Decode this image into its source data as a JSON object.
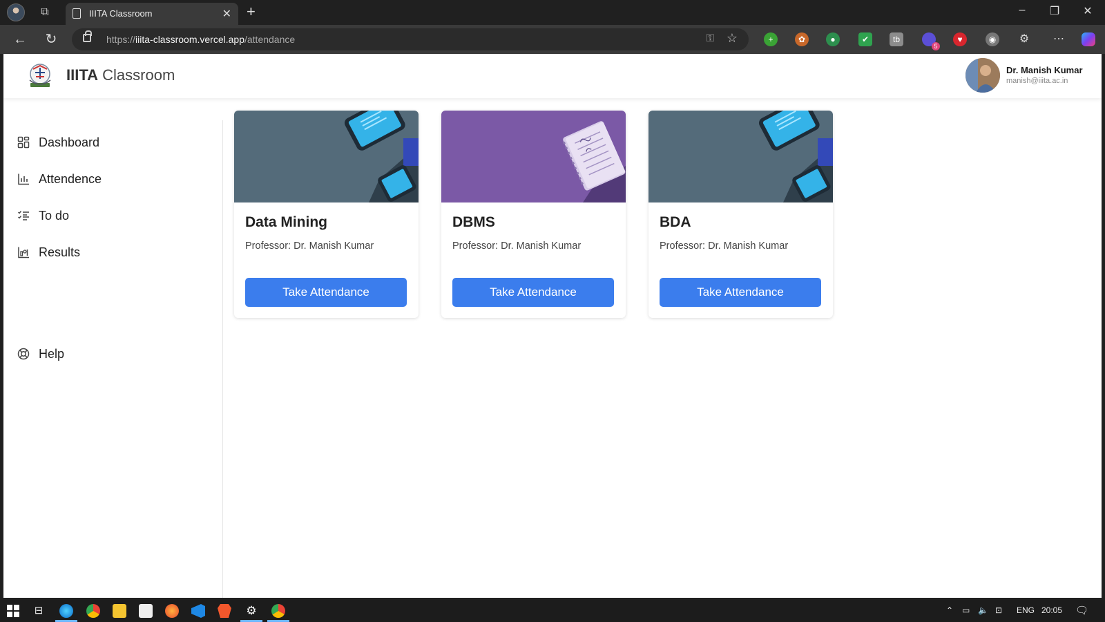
{
  "browser": {
    "tab_title": "IIITA Classroom",
    "url_prefix": "https://",
    "url_host": "iiita-classroom.vercel.app",
    "url_path": "/attendance"
  },
  "header": {
    "brand_bold": "IIITA",
    "brand_light": "Classroom",
    "user_name": "Dr. Manish Kumar",
    "user_email": "manish@iiita.ac.in"
  },
  "sidebar": {
    "items": [
      {
        "label": "Dashboard",
        "icon": "dashboard-icon"
      },
      {
        "label": "Attendence",
        "icon": "bar-chart-icon"
      },
      {
        "label": "To do",
        "icon": "checklist-icon"
      },
      {
        "label": "Results",
        "icon": "results-chart-icon"
      }
    ],
    "help": {
      "label": "Help",
      "icon": "lifebuoy-icon"
    }
  },
  "courses": [
    {
      "title": "Data Mining",
      "professor": "Professor: Dr. Manish Kumar",
      "button": "Take Attendance",
      "banner_color": "#546b7a"
    },
    {
      "title": "DBMS",
      "professor": "Professor: Dr. Manish Kumar",
      "button": "Take Attendance",
      "banner_color": "#7b59a6"
    },
    {
      "title": "BDA",
      "professor": "Professor: Dr. Manish Kumar",
      "button": "Take Attendance",
      "banner_color": "#546b7a"
    }
  ],
  "extension_badge": "5",
  "taskbar": {
    "language": "ENG",
    "time": "20:05"
  },
  "colors": {
    "accent": "#3b7ded"
  }
}
